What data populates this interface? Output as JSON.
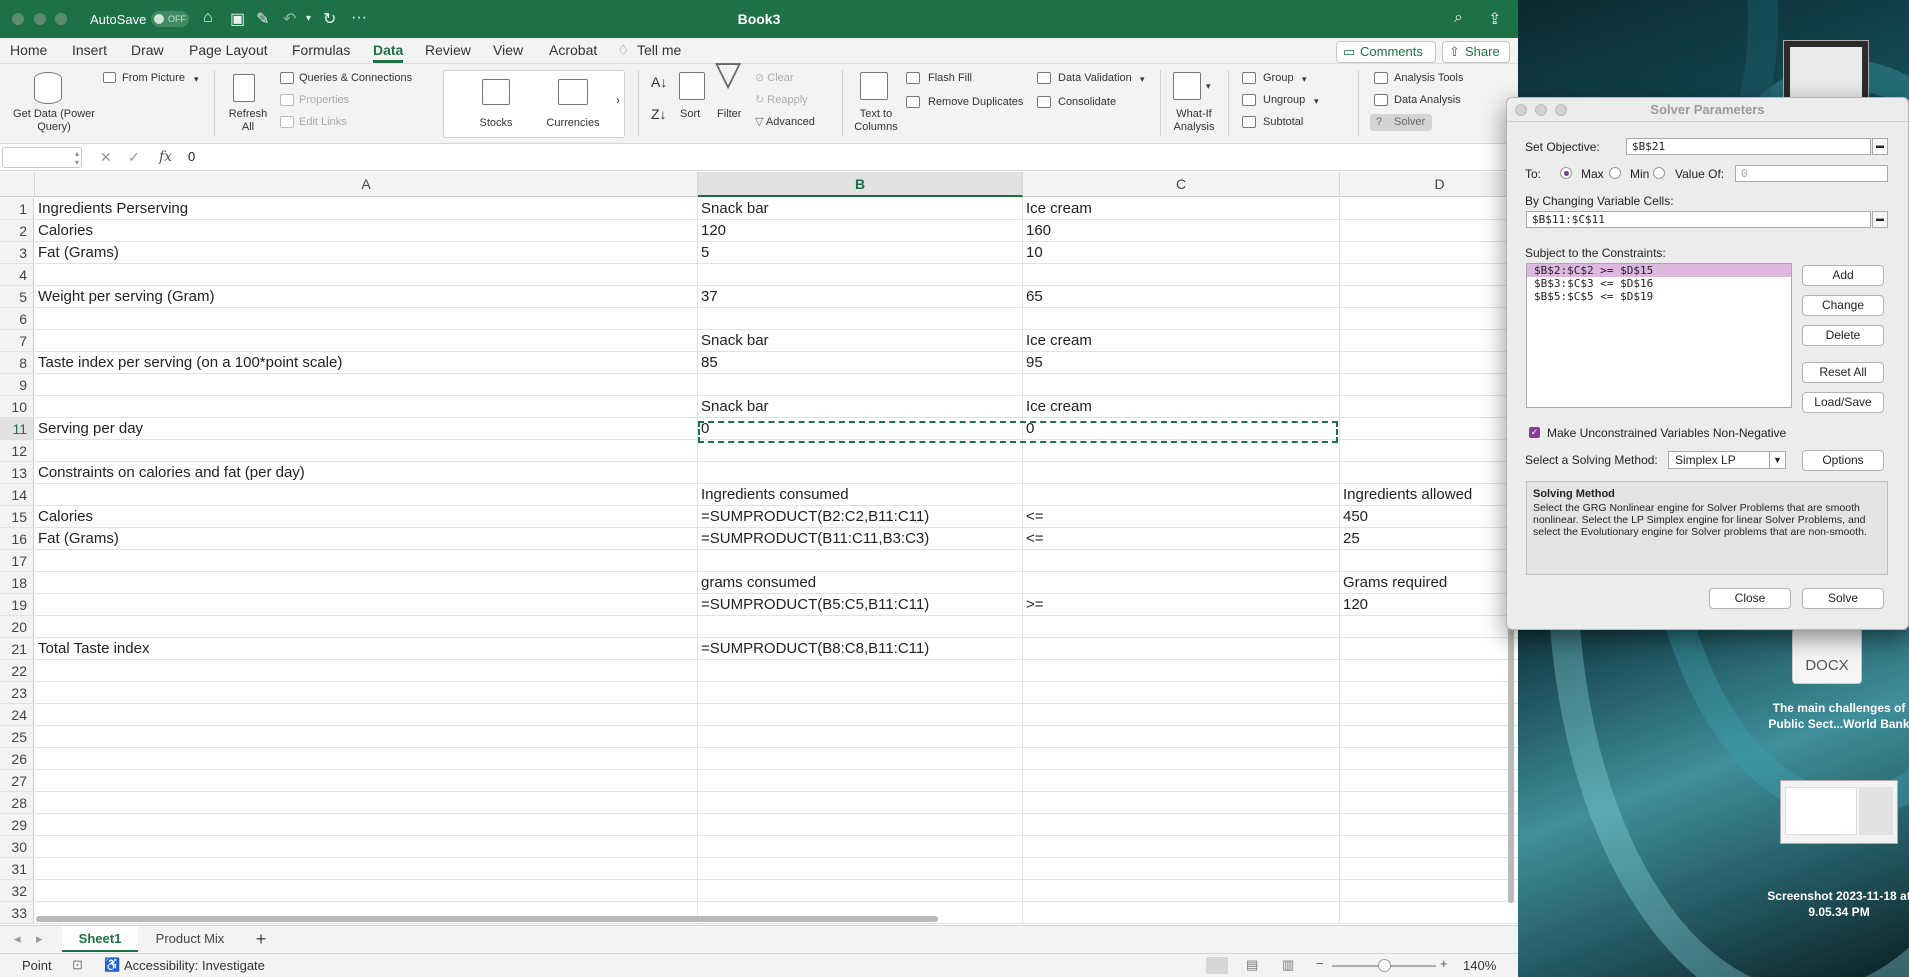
{
  "window": {
    "title": "Book3",
    "autosave_label": "AutoSave",
    "autosave_state": "OFF"
  },
  "menu": {
    "tabs": [
      "Home",
      "Insert",
      "Draw",
      "Page Layout",
      "Formulas",
      "Data",
      "Review",
      "View",
      "Acrobat"
    ],
    "active_tab": "Data",
    "tell_me": "Tell me",
    "comments": "Comments",
    "share": "Share"
  },
  "ribbon": {
    "get_data": "Get Data (Power Query)",
    "from_picture": "From Picture",
    "refresh_all": "Refresh All",
    "queries_connections": "Queries & Connections",
    "properties": "Properties",
    "edit_links": "Edit Links",
    "stocks": "Stocks",
    "currencies": "Currencies",
    "sort": "Sort",
    "filter": "Filter",
    "clear": "Clear",
    "reapply": "Reapply",
    "advanced": "Advanced",
    "text_to_columns": "Text to Columns",
    "flash_fill": "Flash Fill",
    "remove_duplicates": "Remove Duplicates",
    "data_validation": "Data Validation",
    "consolidate": "Consolidate",
    "what_if": "What-If Analysis",
    "group": "Group",
    "ungroup": "Ungroup",
    "subtotal": "Subtotal",
    "analysis_tools": "Analysis Tools",
    "data_analysis": "Data Analysis",
    "solver": "Solver"
  },
  "formula_bar": {
    "fx": "fx",
    "value": "0"
  },
  "sheet": {
    "columns": [
      "A",
      "B",
      "C",
      "D"
    ],
    "rows": [
      [
        "Ingredients Perserving",
        "Snack bar",
        "Ice cream",
        ""
      ],
      [
        "Calories",
        "120",
        "160",
        ""
      ],
      [
        "Fat (Grams)",
        "5",
        "10",
        ""
      ],
      [
        "",
        "",
        "",
        ""
      ],
      [
        "Weight per serving (Gram)",
        "37",
        "65",
        ""
      ],
      [
        "",
        "",
        "",
        ""
      ],
      [
        "",
        "Snack bar",
        "Ice cream",
        ""
      ],
      [
        "Taste index per serving (on a 100*point scale)",
        "85",
        "95",
        ""
      ],
      [
        "",
        "",
        "",
        ""
      ],
      [
        "",
        "Snack bar",
        "Ice cream",
        ""
      ],
      [
        "Serving per day",
        "0",
        "0",
        ""
      ],
      [
        "",
        "",
        "",
        ""
      ],
      [
        "Constraints on calories and fat (per day)",
        "",
        "",
        ""
      ],
      [
        "",
        "Ingredients consumed",
        "",
        "Ingredients allowed"
      ],
      [
        "Calories",
        "=SUMPRODUCT(B2:C2,B11:C11)",
        "<=",
        "450"
      ],
      [
        "Fat (Grams)",
        "=SUMPRODUCT(B11:C11,B3:C3)",
        "<=",
        "25"
      ],
      [
        "",
        "",
        "",
        ""
      ],
      [
        "",
        "grams consumed",
        "",
        "Grams required"
      ],
      [
        "",
        "=SUMPRODUCT(B5:C5,B11:C11)",
        ">=",
        "120"
      ],
      [
        "",
        "",
        "",
        ""
      ],
      [
        "Total Taste index",
        "=SUMPRODUCT(B8:C8,B11:C11)",
        "",
        ""
      ],
      [
        "",
        "",
        "",
        ""
      ],
      [
        "",
        "",
        "",
        ""
      ],
      [
        "",
        "",
        "",
        ""
      ],
      [
        "",
        "",
        "",
        ""
      ],
      [
        "",
        "",
        "",
        ""
      ],
      [
        "",
        "",
        "",
        ""
      ],
      [
        "",
        "",
        "",
        ""
      ],
      [
        "",
        "",
        "",
        ""
      ],
      [
        "",
        "",
        "",
        ""
      ],
      [
        "",
        "",
        "",
        ""
      ],
      [
        "",
        "",
        "",
        ""
      ],
      [
        "",
        "",
        "",
        ""
      ]
    ],
    "tabs": [
      "Sheet1",
      "Product Mix"
    ],
    "active_tab": "Sheet1"
  },
  "status": {
    "mode": "Point",
    "accessibility": "Accessibility: Investigate",
    "zoom": "140%"
  },
  "solver": {
    "title": "Solver Parameters",
    "set_objective_label": "Set Objective:",
    "set_objective_value": "$B$21",
    "to_label": "To:",
    "max_label": "Max",
    "min_label": "Min",
    "value_of_label": "Value Of:",
    "value_of_value": "0",
    "selected_goal": "Max",
    "changing_cells_label": "By Changing Variable Cells:",
    "changing_cells_value": "$B$11:$C$11",
    "constraints_label": "Subject to the Constraints:",
    "constraints": [
      "$B$2:$C$2 >= $D$15",
      "$B$3:$C$3 <= $D$16",
      "$B$5:$C$5 <= $D$19"
    ],
    "buttons": {
      "add": "Add",
      "change": "Change",
      "delete": "Delete",
      "reset_all": "Reset All",
      "load_save": "Load/Save",
      "options": "Options",
      "close": "Close",
      "solve": "Solve"
    },
    "nonneg_label": "Make Unconstrained Variables Non-Negative",
    "nonneg_checked": true,
    "method_label": "Select a Solving Method:",
    "method_value": "Simplex LP",
    "method_box_title": "Solving Method",
    "method_box_text": "Select the GRG Nonlinear engine for Solver Problems that are smooth nonlinear. Select the LP Simplex engine for linear Solver Problems, and select the Evolutionary engine for Solver problems that are non-smooth."
  },
  "desktop": {
    "docx_label": "DOCX",
    "file1_name": "The main challenges of Public Sect...World Bank",
    "file2_name": "Screenshot 2023-11-18 at 9.05.34 PM"
  }
}
